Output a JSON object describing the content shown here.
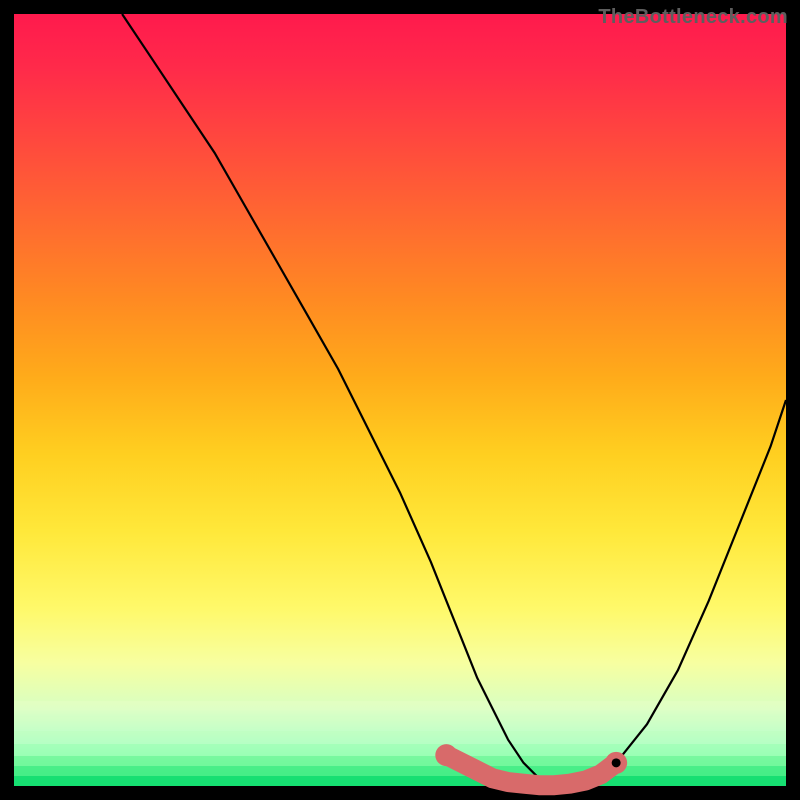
{
  "watermark": "TheBottleneck.com",
  "colors": {
    "curve_stroke": "#000000",
    "marker_fill": "#d86a6a",
    "marker_stroke": "#c95a5a",
    "dot_fill": "#000000"
  },
  "chart_data": {
    "type": "line",
    "title": "",
    "xlabel": "",
    "ylabel": "",
    "xlim": [
      0,
      100
    ],
    "ylim": [
      0,
      100
    ],
    "series": [
      {
        "name": "bottleneck-curve",
        "x": [
          14,
          18,
          22,
          26,
          30,
          34,
          38,
          42,
          46,
          50,
          54,
          56,
          58,
          60,
          62,
          64,
          66,
          68,
          70,
          72,
          74,
          78,
          82,
          86,
          90,
          94,
          98,
          100
        ],
        "values": [
          100,
          94,
          88,
          82,
          75,
          68,
          61,
          54,
          46,
          38,
          29,
          24,
          19,
          14,
          10,
          6,
          3,
          1,
          0,
          0,
          1,
          3,
          8,
          15,
          24,
          34,
          44,
          50
        ]
      },
      {
        "name": "optimal-band-markers",
        "x": [
          56,
          58,
          60,
          62,
          64,
          66,
          68,
          70,
          72,
          74,
          76,
          78
        ],
        "values": [
          4,
          3,
          2,
          1,
          0.5,
          0.3,
          0.1,
          0.1,
          0.3,
          0.7,
          1.5,
          3
        ]
      },
      {
        "name": "optimal-point",
        "x": [
          78
        ],
        "values": [
          3
        ]
      }
    ]
  }
}
